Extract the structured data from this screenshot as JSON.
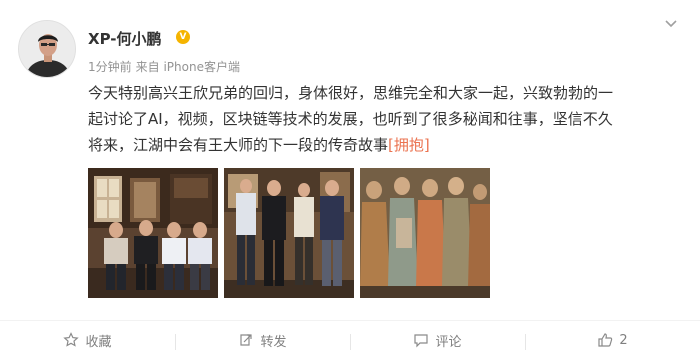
{
  "post": {
    "author": {
      "name": "XP-何小鹏",
      "verified_icon": "verified-v-icon",
      "badge_color": "#f5b400"
    },
    "meta": {
      "time": "1分钟前",
      "source": "来自 iPhone客户端"
    },
    "text": {
      "line1": "今天特别高兴王欣兄弟的回归，身体很好，思维完全和大家一起，兴致勃勃的一",
      "line2": "起讨论了AI，视频，区块链等技术的发展，也听到了很多秘闻和往事，坚信不久",
      "line3": "将来，江湖中会有王大师的下一段的传奇故事",
      "emoji": "[拥抱]"
    },
    "photos": [
      {
        "name": "photo-four-men-sitting"
      },
      {
        "name": "photo-four-men-standing"
      },
      {
        "name": "photo-mural"
      }
    ]
  },
  "actions": {
    "favorite": {
      "label": "收藏",
      "icon": "star-icon"
    },
    "repost": {
      "label": "转发",
      "icon": "repost-icon"
    },
    "comment": {
      "label": "评论",
      "icon": "comment-icon"
    },
    "like": {
      "label": "2",
      "icon": "thumbs-up-icon"
    }
  },
  "colors": {
    "text": "#333333",
    "meta": "#939393",
    "emoji": "#eb7350",
    "action": "#808080"
  }
}
